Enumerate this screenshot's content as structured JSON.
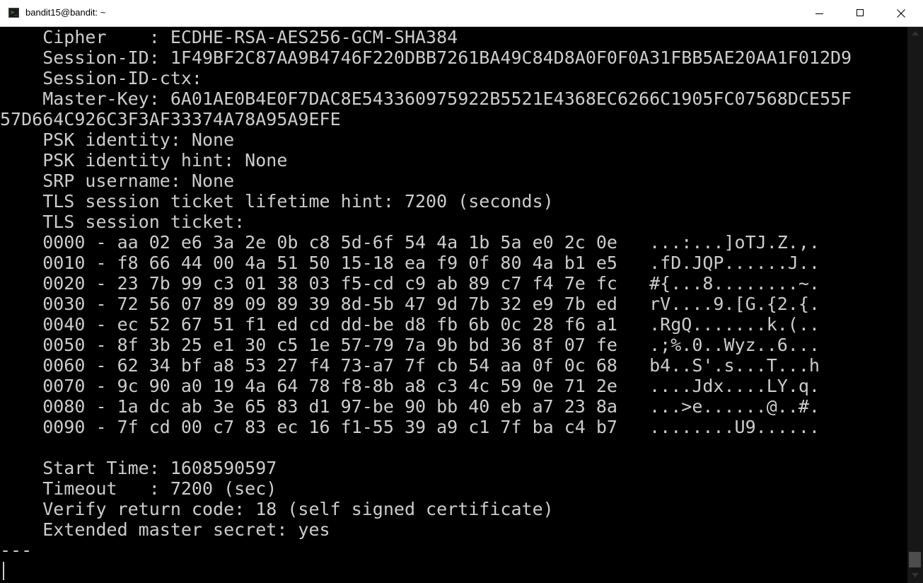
{
  "window": {
    "title": "bandit15@bandit: ~",
    "icon": "terminal-icon"
  },
  "titlebar_buttons": {
    "minimize": "minimize-icon",
    "maximize": "maximize-icon",
    "close": "close-icon"
  },
  "terminal": {
    "lines": [
      "    Cipher    : ECDHE-RSA-AES256-GCM-SHA384",
      "    Session-ID: 1F49BF2C87AA9B4746F220DBB7261BA49C84D8A0F0F0A31FBB5AE20AA1F012D9",
      "    Session-ID-ctx:",
      "    Master-Key: 6A01AE0B4E0F7DAC8E543360975922B5521E4368EC6266C1905FC07568DCE55F",
      "57D664C926C3F3AF33374A78A95A9EFE",
      "    PSK identity: None",
      "    PSK identity hint: None",
      "    SRP username: None",
      "    TLS session ticket lifetime hint: 7200 (seconds)",
      "    TLS session ticket:",
      "    0000 - aa 02 e6 3a 2e 0b c8 5d-6f 54 4a 1b 5a e0 2c 0e   ...:...]oTJ.Z.,.",
      "    0010 - f8 66 44 00 4a 51 50 15-18 ea f9 0f 80 4a b1 e5   .fD.JQP......J..",
      "    0020 - 23 7b 99 c3 01 38 03 f5-cd c9 ab 89 c7 f4 7e fc   #{...8........~.",
      "    0030 - 72 56 07 89 09 89 39 8d-5b 47 9d 7b 32 e9 7b ed   rV....9.[G.{2.{.",
      "    0040 - ec 52 67 51 f1 ed cd dd-be d8 fb 6b 0c 28 f6 a1   .RgQ.......k.(..",
      "    0050 - 8f 3b 25 e1 30 c5 1e 57-79 7a 9b bd 36 8f 07 fe   .;%.0..Wyz..6...",
      "    0060 - 62 34 bf a8 53 27 f4 73-a7 7f cb 54 aa 0f 0c 68   b4..S'.s...T...h",
      "    0070 - 9c 90 a0 19 4a 64 78 f8-8b a8 c3 4c 59 0e 71 2e   ....Jdx....LY.q.",
      "    0080 - 1a dc ab 3e 65 83 d1 97-be 90 bb 40 eb a7 23 8a   ...>e......@..#.",
      "    0090 - 7f cd 00 c7 83 ec 16 f1-55 39 a9 c1 7f ba c4 b7   ........U9......",
      "",
      "    Start Time: 1608590597",
      "    Timeout   : 7200 (sec)",
      "    Verify return code: 18 (self signed certificate)",
      "    Extended master secret: yes",
      "---",
      ""
    ]
  },
  "scrollbar": {
    "up": "arrow-up-icon",
    "down": "arrow-down-icon"
  }
}
